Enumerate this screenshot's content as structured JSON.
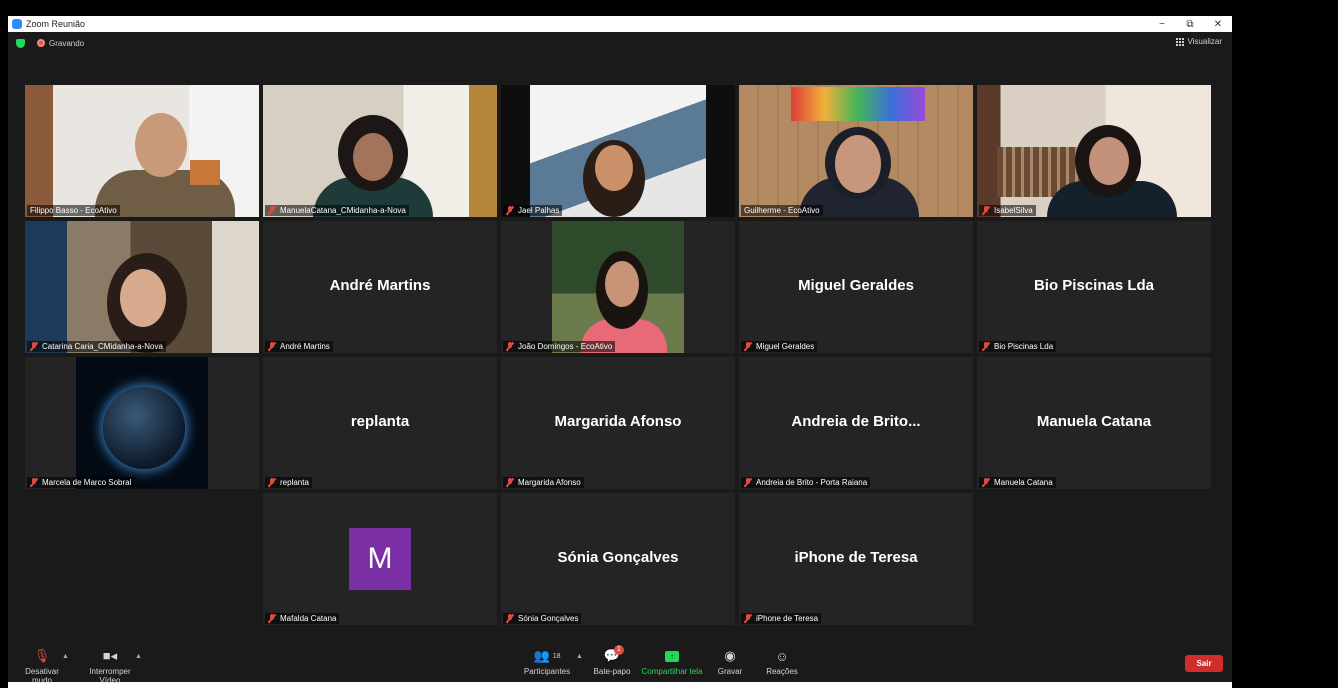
{
  "window": {
    "title": "Zoom Reunião",
    "minimize": "−",
    "restore": "⧉",
    "close": "✕"
  },
  "status": {
    "recording_label": "Gravando",
    "view_label": "Visualizar"
  },
  "participants_tiles": [
    {
      "label": "Filippo Basso - EcoAtivo",
      "muted": false,
      "video": true
    },
    {
      "label": "ManuelaCatana_CMidanha-a-Nova",
      "muted": true,
      "video": true
    },
    {
      "label": "Jael Palhas",
      "muted": true,
      "video": true
    },
    {
      "label": "Guilherme - EcoAtivo",
      "muted": false,
      "video": true,
      "active_speaker": true
    },
    {
      "label": "IsabelSilva",
      "muted": true,
      "video": true
    },
    {
      "label": "Catarina Caria_CMidanha-a-Nova",
      "muted": true,
      "video": true
    },
    {
      "label": "André Martins",
      "display_name": "André Martins",
      "muted": true,
      "video": false
    },
    {
      "label": "João Domingos - EcoAtivo",
      "muted": true,
      "video": true
    },
    {
      "label": "Miguel Geraldes",
      "display_name": "Miguel Geraldes",
      "muted": true,
      "video": false
    },
    {
      "label": "Bio Piscinas Lda",
      "display_name": "Bio Piscinas Lda",
      "muted": true,
      "video": false
    },
    {
      "label": "Marcela de Marco Sobral",
      "muted": true,
      "video": true
    },
    {
      "label": "replanta",
      "display_name": "replanta",
      "muted": true,
      "video": false
    },
    {
      "label": "Margarida Afonso",
      "display_name": "Margarida Afonso",
      "muted": true,
      "video": false
    },
    {
      "label": "Andreia de Brito  - Porta Raiana",
      "display_name": "Andreia de Brito...",
      "muted": true,
      "video": false
    },
    {
      "label": "Manuela Catana",
      "display_name": "Manuela Catana",
      "muted": true,
      "video": false
    },
    {
      "label": "Mafalda Catana",
      "avatar_letter": "M",
      "avatar_color": "#7b2fa5",
      "muted": true,
      "video": false
    },
    {
      "label": "Sónia Gonçalves",
      "display_name": "Sónia Gonçalves",
      "muted": true,
      "video": false
    },
    {
      "label": "iPhone de Teresa",
      "display_name": "iPhone de Teresa",
      "muted": true,
      "video": false
    }
  ],
  "toolbar": {
    "mute_label": "Desativar mudo",
    "video_label": "Interromper Vídeo",
    "participants_label": "Participantes",
    "participants_count": "18",
    "chat_label": "Bate-papo",
    "chat_badge": "1",
    "share_label": "Compartilhar tela",
    "record_label": "Gravar",
    "reactions_label": "Reações",
    "leave_label": "Sair"
  },
  "colors": {
    "accent_green": "#23d959",
    "active_speaker": "#d9e75b",
    "leave_red": "#d12d2d",
    "muted_red": "#e04a3f"
  }
}
